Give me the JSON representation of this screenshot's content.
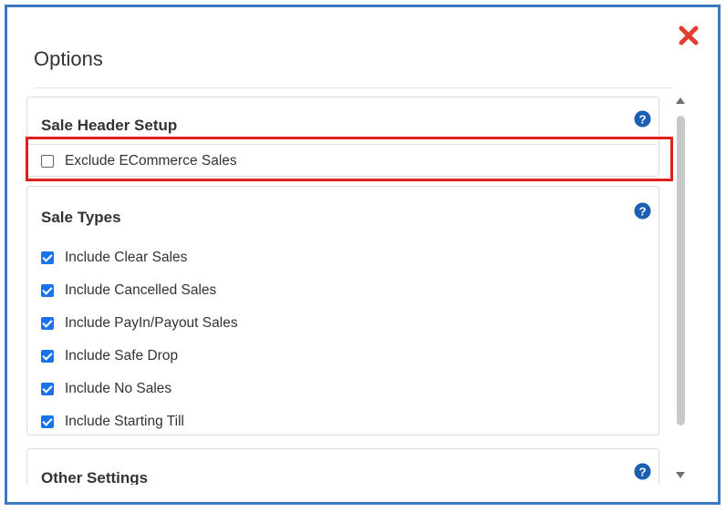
{
  "dialog": {
    "title": "Options",
    "close_icon": "close-x-icon",
    "accent_color": "#3b7ac0",
    "close_color": "#e23d2f"
  },
  "sections": {
    "sale_header": {
      "title": "Sale Header Setup",
      "help_icon": "question-circle-icon",
      "options": [
        {
          "label": "Exclude ECommerce Sales",
          "checked": false
        }
      ]
    },
    "sale_types": {
      "title": "Sale Types",
      "help_icon": "question-circle-icon",
      "options": [
        {
          "label": "Include Clear Sales",
          "checked": true
        },
        {
          "label": "Include Cancelled Sales",
          "checked": true
        },
        {
          "label": "Include PayIn/Payout Sales",
          "checked": true
        },
        {
          "label": "Include Safe Drop",
          "checked": true
        },
        {
          "label": "Include No Sales",
          "checked": true
        },
        {
          "label": "Include Starting Till",
          "checked": true
        }
      ]
    },
    "other_settings": {
      "title": "Other Settings",
      "help_icon": "question-circle-icon"
    }
  },
  "annotation": {
    "highlight_color": "#e0201b"
  }
}
